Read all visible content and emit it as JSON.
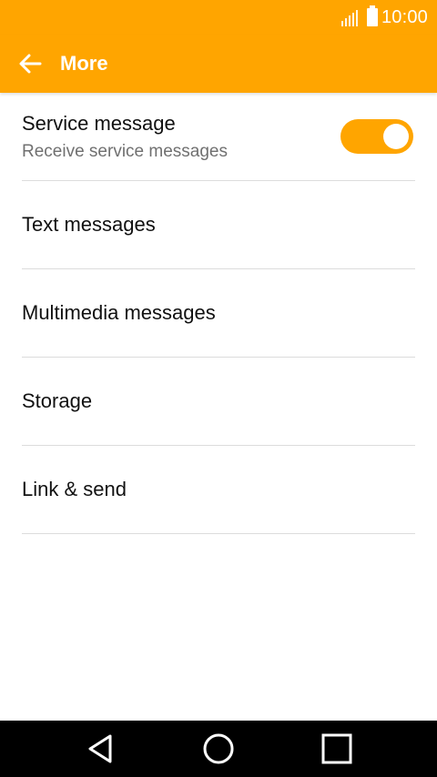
{
  "status_bar": {
    "time": "10:00",
    "icons": [
      "signal-icon",
      "battery-icon"
    ]
  },
  "app_bar": {
    "title": "More",
    "back_icon": "back-arrow-icon"
  },
  "settings": {
    "service_message": {
      "title": "Service message",
      "subtitle": "Receive service messages",
      "toggle_on": true
    },
    "items": [
      {
        "label": "Text messages"
      },
      {
        "label": "Multimedia messages"
      },
      {
        "label": "Storage"
      },
      {
        "label": "Link & send"
      }
    ]
  },
  "nav_bar": {
    "icons": [
      "back-triangle-icon",
      "home-circle-icon",
      "recents-square-icon"
    ]
  },
  "colors": {
    "accent": "#FFA500",
    "text_primary": "#111111",
    "text_secondary": "#707070",
    "divider": "#DCDCDC",
    "nav_bg": "#000000"
  }
}
